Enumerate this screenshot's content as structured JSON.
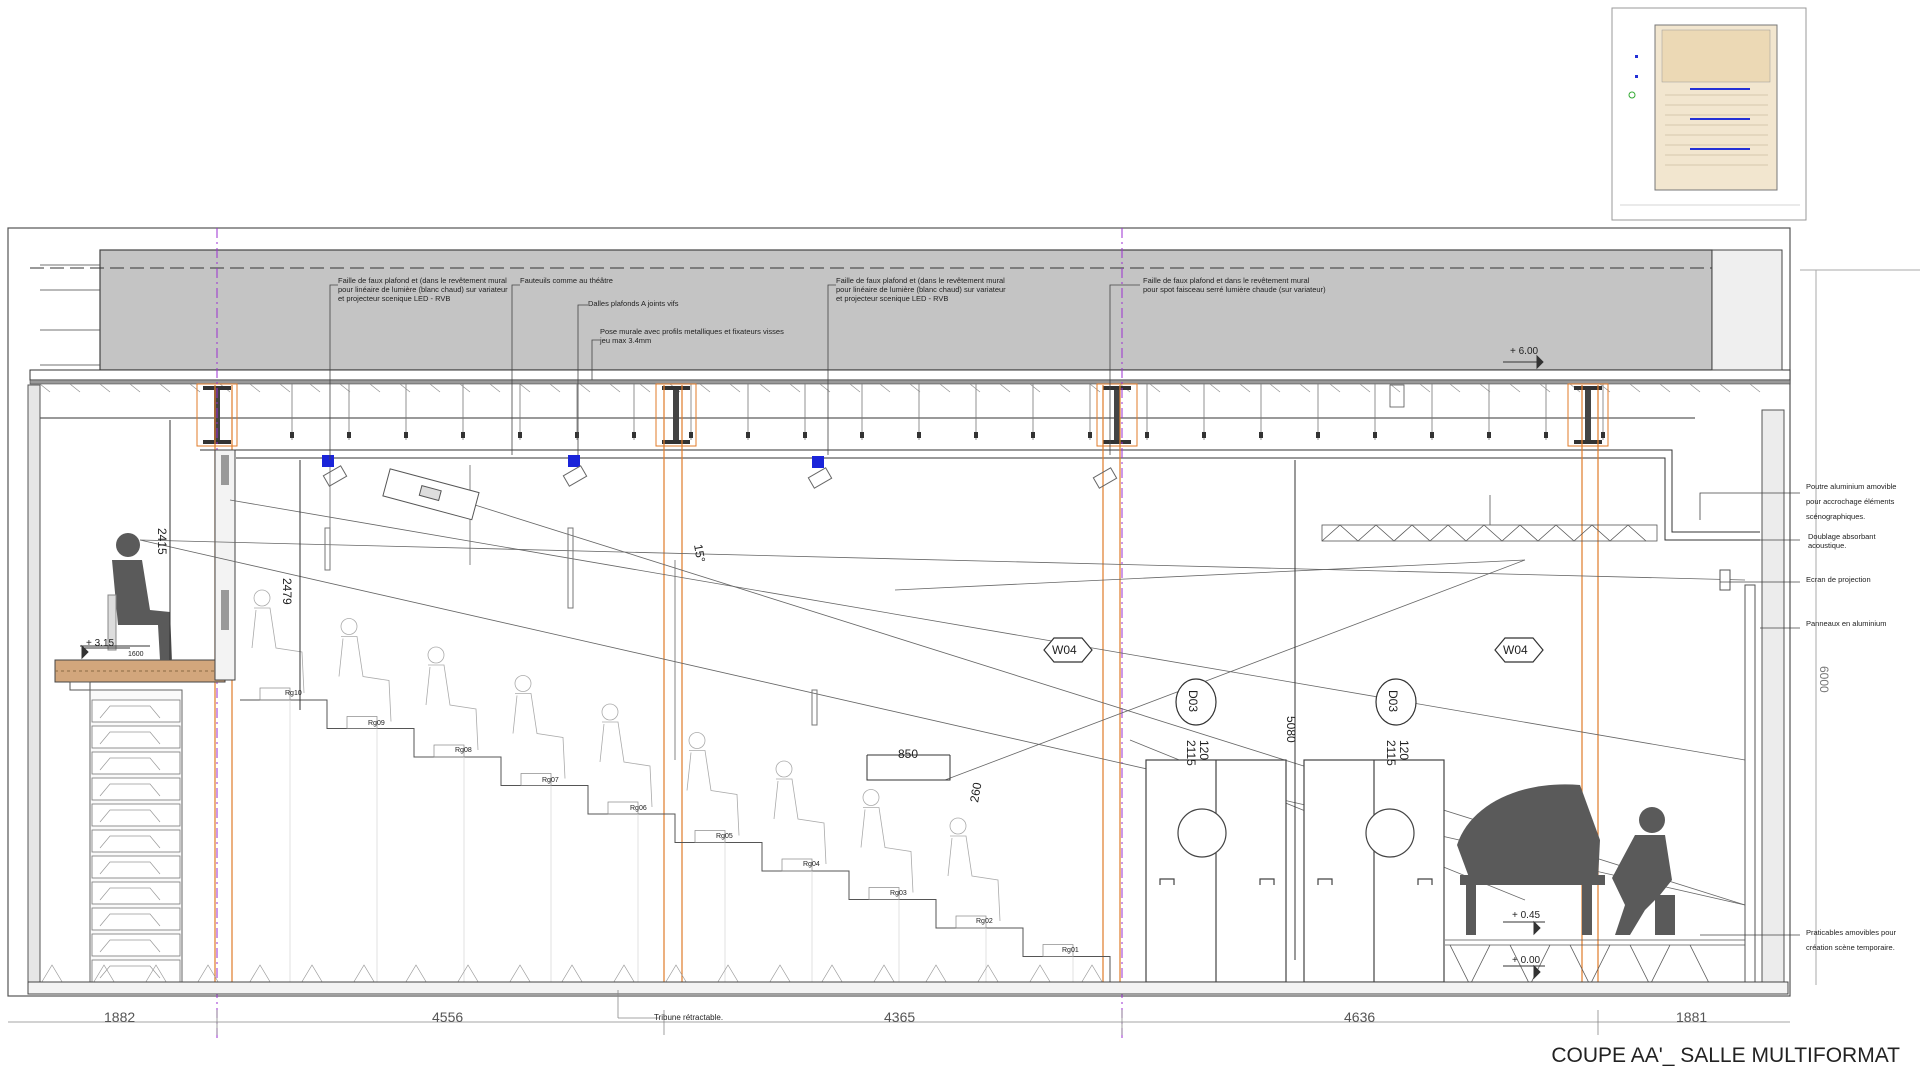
{
  "title": "COUPE AA'_ SALLE MULTIFORMAT",
  "annotations_top": [
    "Faille de faux plafond et (dans le revêtement mural",
    "pour linéaire de lumière (blanc chaud) sur variateur",
    "et projecteur scenique LED - RVB",
    "Fauteuils  comme au théâtre",
    "Dalles plafonds A joints vifs",
    "Pose murale avec profils metalliques et fixateurs visses",
    "jeu max 3.4mm",
    "Faille de faux plafond et (dans le revêtement mural",
    "pour linéaire de lumière (blanc chaud) sur variateur",
    "et projecteur scenique LED - RVB",
    "Faille de faux plafond et dans le revêtement mural",
    "pour spot faisceau serré lumière chaude (sur variateur)"
  ],
  "annotations_right": [
    "Poutre aluminium amovible",
    "pour accrochage éléments",
    "scénographiques.",
    "Doublage absorbant",
    "acoustique.",
    "Ecran de projection",
    "Panneaux en aluminium",
    "Praticables amovibles pour",
    "création scène temporaire."
  ],
  "levels": [
    "+ 6.00",
    "+ 3.15",
    "+ 0.45",
    "+ 0.00"
  ],
  "dims": {
    "bottom": [
      "1882",
      "4556",
      "4365",
      "4636",
      "1881"
    ],
    "d2415": "2415",
    "d2479": "2479",
    "d1600": "1600",
    "angle": "15°",
    "d850": "850",
    "d260": "260",
    "d5080": "5080",
    "d6000": "6000",
    "d2115": "2115",
    "d120": "120"
  },
  "tags": {
    "w04": "W04",
    "d03": "D03"
  },
  "rows": [
    "Rg10",
    "Rg09",
    "Rg08",
    "Rg07",
    "Rg06",
    "Rg05",
    "Rg04",
    "Rg03",
    "Rg02",
    "Rg01"
  ],
  "tribune_label": "Tribune rétractable.",
  "colors": {
    "ceiling": "#c4c4c4",
    "column": "#e07b2a",
    "axis": "#9b2fd1",
    "spot": "#1a24d9",
    "silhouette": "#5a5a5a"
  }
}
